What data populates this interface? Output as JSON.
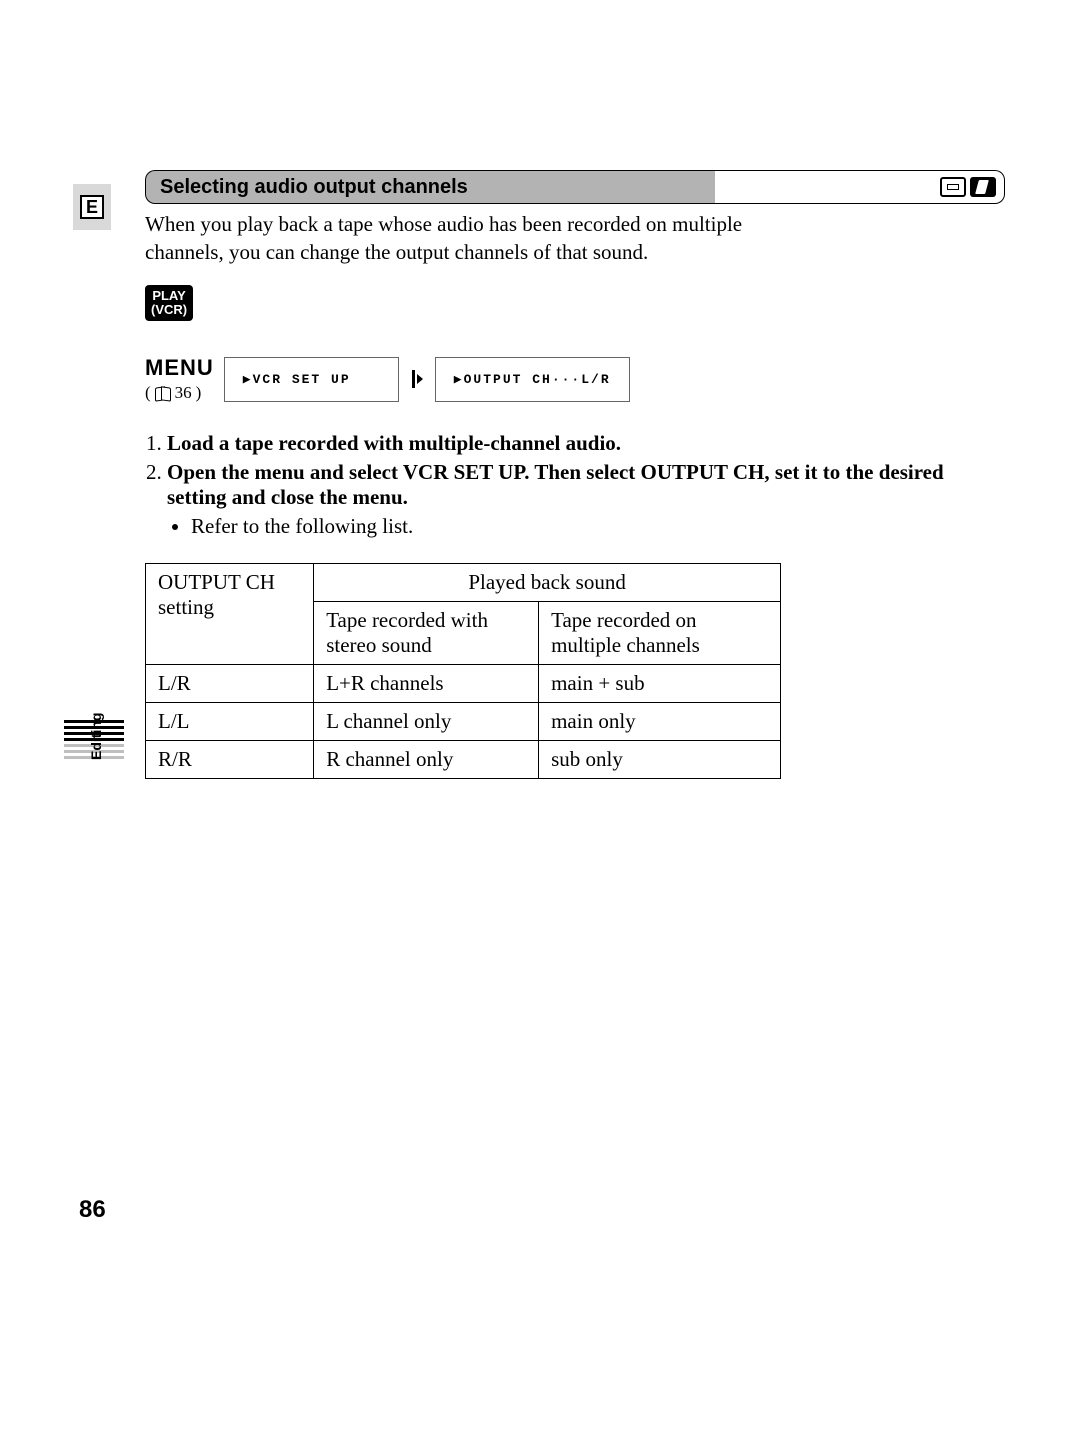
{
  "side_letter": "E",
  "section_title": "Selecting audio output channels",
  "intro": "When you play back a tape whose audio has been recorded on multiple channels, you can change the output channels of that sound.",
  "play_badge_line1": "PLAY",
  "play_badge_line2": "(VCR)",
  "menu_label": "MENU",
  "menu_ref_num": "36",
  "menu_box1": "▶VCR SET UP",
  "menu_box2": "▶OUTPUT CH···L/R",
  "steps": [
    "Load a tape recorded with multiple-channel audio.",
    "Open the menu and select VCR SET UP. Then select OUTPUT CH, set it to the desired setting and close the menu."
  ],
  "step2_sub": "Refer to the following list.",
  "table": {
    "col1_header": "OUTPUT CH setting",
    "col23_header": "Played back sound",
    "col2_sub": "Tape recorded with stereo sound",
    "col3_sub": "Tape recorded on multiple channels",
    "rows": [
      {
        "c1": "L/R",
        "c2": "L+R channels",
        "c3": "main + sub"
      },
      {
        "c1": "L/L",
        "c2": "L channel only",
        "c3": "main only"
      },
      {
        "c1": "R/R",
        "c2": "R channel only",
        "c3": "sub only"
      }
    ]
  },
  "tab_label": "Editing",
  "page_number": "86"
}
